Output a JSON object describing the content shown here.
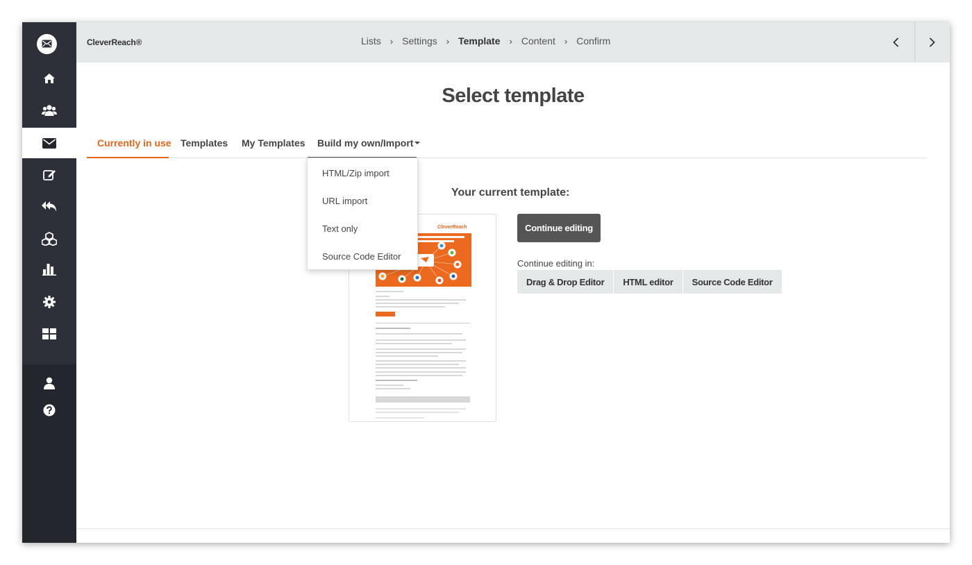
{
  "header": {
    "brand": "CleverReach®",
    "breadcrumbs": [
      "Lists",
      "Settings",
      "Template",
      "Content",
      "Confirm"
    ],
    "current_index": 2
  },
  "sidebar": {
    "icons": [
      "mail-logo-icon",
      "home-icon",
      "users-icon",
      "envelope-icon",
      "edit-icon",
      "reply-all-icon",
      "cubes-icon",
      "bar-chart-icon",
      "gear-icon",
      "grid-icon",
      "user-icon",
      "help-icon"
    ],
    "active": "envelope-icon"
  },
  "main": {
    "title": "Select template",
    "tabs": [
      {
        "label": "Currently in use"
      },
      {
        "label": "Templates"
      },
      {
        "label": "My Templates"
      },
      {
        "label": "Build my own/Import"
      }
    ],
    "current_template_title": "Your current template:",
    "continue_label": "Continue editing",
    "continue_in_label": "Continue editing in:",
    "editors": [
      "Drag & Drop Editor",
      "HTML editor",
      "Source Code Editor"
    ]
  },
  "dropdown": {
    "items": [
      "HTML/Zip import",
      "URL import",
      "Text only",
      "Source Code Editor"
    ]
  },
  "preview": {
    "logo_text": "CleverReach"
  },
  "colors": {
    "accent": "#e8641b",
    "sidebar": "#2d3038",
    "header": "#e4e8e8",
    "button_dark": "#555555"
  }
}
